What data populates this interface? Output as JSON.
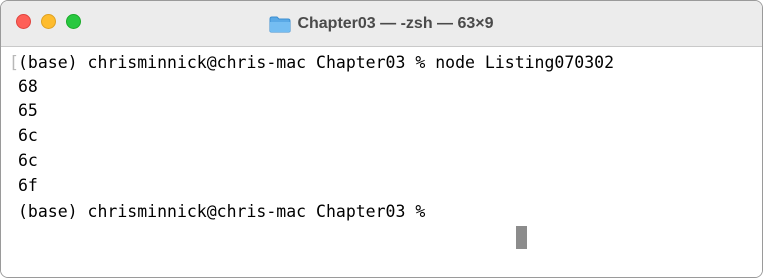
{
  "window": {
    "title": "Chapter03 — -zsh — 63×9",
    "title_icon": "folder-icon",
    "traffic_lights": {
      "close_color": "#fe5f57",
      "minimize_color": "#febc2e",
      "zoom_color": "#28c840"
    }
  },
  "terminal": {
    "lines": [
      "(base) chrisminnick@chris-mac Chapter03 % node Listing070302",
      "68",
      "65",
      "6c",
      "6c",
      "6f",
      "(base) chrisminnick@chris-mac Chapter03 % "
    ],
    "cursor": "block-cursor"
  },
  "colors": {
    "titlebar": "#ececec",
    "terminal_background": "#ffffff",
    "text": "#000000",
    "cursor": "#8c8c8c"
  }
}
